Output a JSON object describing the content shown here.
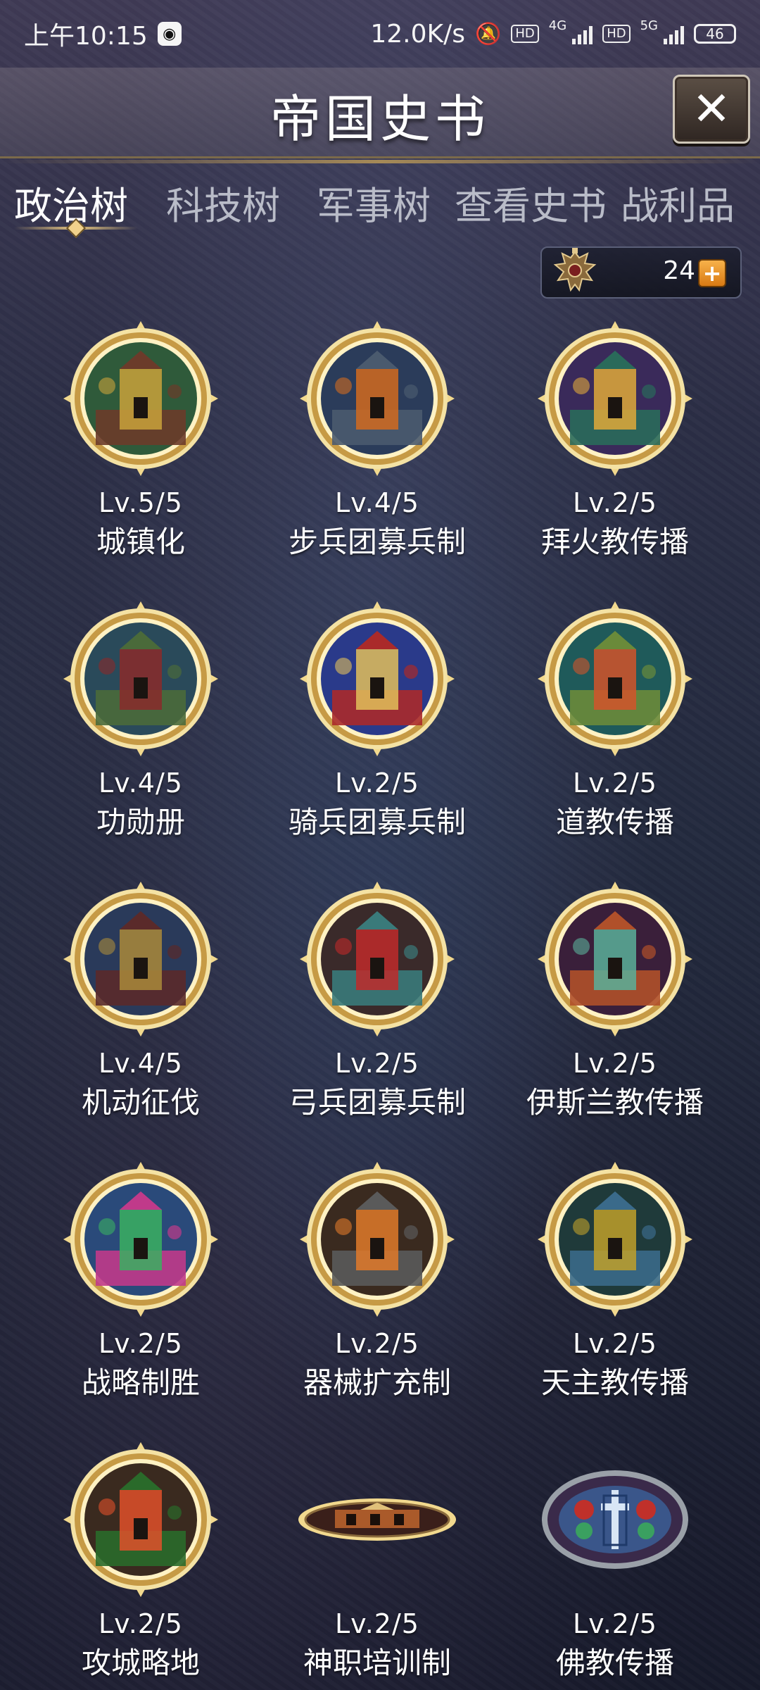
{
  "status_bar": {
    "time": "上午10:15",
    "net_speed": "12.0K/s",
    "net1": "4G",
    "net2": "5G",
    "hd": "HD",
    "battery": "46"
  },
  "header": {
    "title": "帝国史书"
  },
  "tabs": [
    {
      "label": "政治树",
      "active": true
    },
    {
      "label": "科技树",
      "active": false
    },
    {
      "label": "军事树",
      "active": false
    },
    {
      "label": "查看史书",
      "active": false
    },
    {
      "label": "战利品",
      "active": false
    }
  ],
  "currency": {
    "value": "24",
    "emblem_icon": "double-eagle-emblem-icon",
    "add_icon": "plus-icon"
  },
  "colors": {
    "gold": "#e8c878",
    "tab_active": "#ffffff",
    "tab_inactive": "#b9bcc8"
  },
  "policies": [
    {
      "level": "Lv.5/5",
      "name": "城镇化",
      "icon": "town-icon"
    },
    {
      "level": "Lv.4/5",
      "name": "步兵团募兵制",
      "icon": "infantry-icon"
    },
    {
      "level": "Lv.2/5",
      "name": "拜火教传播",
      "icon": "fire-temple-icon"
    },
    {
      "level": "Lv.4/5",
      "name": "功勋册",
      "icon": "hero-statue-icon"
    },
    {
      "level": "Lv.2/5",
      "name": "骑兵团募兵制",
      "icon": "cavalry-icon"
    },
    {
      "level": "Lv.2/5",
      "name": "道教传播",
      "icon": "taoist-shrine-icon"
    },
    {
      "level": "Lv.4/5",
      "name": "机动征伐",
      "icon": "marching-army-icon"
    },
    {
      "level": "Lv.2/5",
      "name": "弓兵团募兵制",
      "icon": "archer-icon"
    },
    {
      "level": "Lv.2/5",
      "name": "伊斯兰教传播",
      "icon": "mosque-icon"
    },
    {
      "level": "Lv.2/5",
      "name": "战略制胜",
      "icon": "knight-charge-icon"
    },
    {
      "level": "Lv.2/5",
      "name": "器械扩充制",
      "icon": "siege-engine-icon"
    },
    {
      "level": "Lv.2/5",
      "name": "天主教传播",
      "icon": "saint-statue-icon"
    },
    {
      "level": "Lv.2/5",
      "name": "攻城略地",
      "icon": "siege-battle-icon"
    },
    {
      "level": "Lv.2/5",
      "name": "神职培训制",
      "icon": "clergy-building-icon"
    },
    {
      "level": "Lv.2/5",
      "name": "佛教传播",
      "icon": "stained-glass-cross-icon"
    }
  ]
}
